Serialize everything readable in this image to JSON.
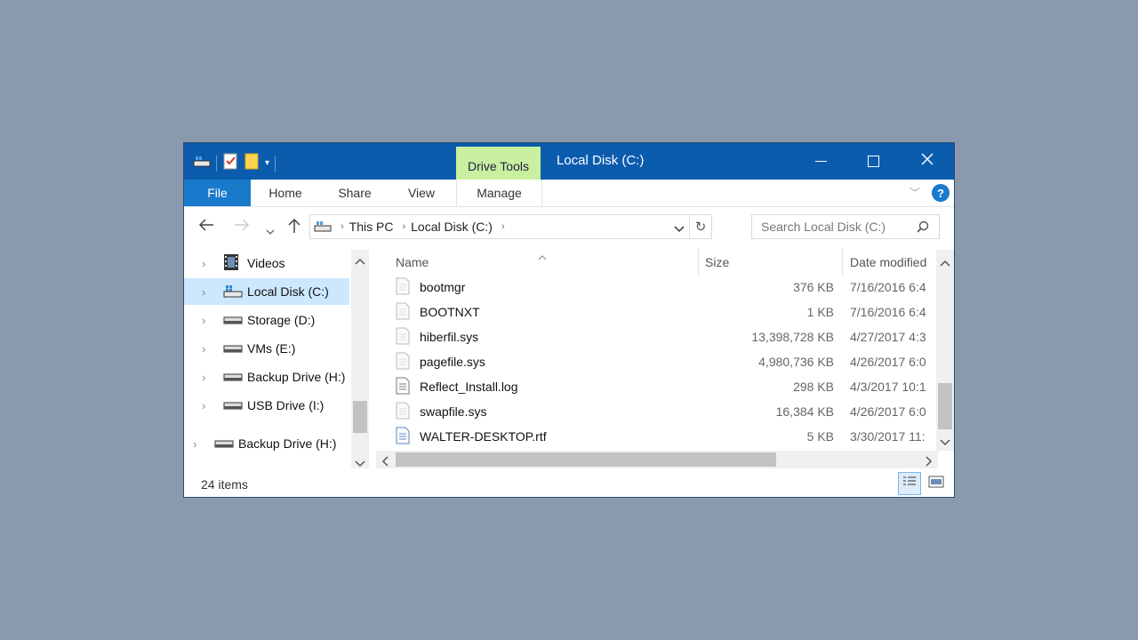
{
  "window": {
    "title": "Local Disk (C:)",
    "context_tab": "Drive Tools",
    "controls": {
      "minimize": "—",
      "maximize": "☐",
      "close": "✕"
    }
  },
  "ribbon": {
    "tabs": [
      {
        "label": "File"
      },
      {
        "label": "Home"
      },
      {
        "label": "Share"
      },
      {
        "label": "View"
      },
      {
        "label": "Manage"
      }
    ],
    "help": "?"
  },
  "address_bar": {
    "breadcrumbs": [
      "This PC",
      "Local Disk (C:)"
    ]
  },
  "search": {
    "placeholder": "Search Local Disk (C:)"
  },
  "nav_pane": {
    "items": [
      {
        "label": "Videos",
        "icon": "videos-icon"
      },
      {
        "label": "Local Disk (C:)",
        "icon": "local-disk-icon",
        "selected": true
      },
      {
        "label": "Storage (D:)",
        "icon": "drive-icon"
      },
      {
        "label": "VMs (E:)",
        "icon": "drive-icon"
      },
      {
        "label": "Backup Drive (H:)",
        "icon": "drive-icon"
      },
      {
        "label": "USB Drive (I:)",
        "icon": "drive-icon"
      },
      {
        "label": "Backup Drive (H:)",
        "icon": "drive-icon"
      }
    ]
  },
  "file_list": {
    "columns": [
      "Name",
      "Size",
      "Date modified"
    ],
    "rows": [
      {
        "name": "bootmgr",
        "size": "376 KB",
        "date": "7/16/2016 6:4"
      },
      {
        "name": "BOOTNXT",
        "size": "1 KB",
        "date": "7/16/2016 6:4"
      },
      {
        "name": "hiberfil.sys",
        "size": "13,398,728 KB",
        "date": "4/27/2017 4:3"
      },
      {
        "name": "pagefile.sys",
        "size": "4,980,736 KB",
        "date": "4/26/2017 6:0"
      },
      {
        "name": "Reflect_Install.log",
        "size": "298 KB",
        "date": "4/3/2017 10:1"
      },
      {
        "name": "swapfile.sys",
        "size": "16,384 KB",
        "date": "4/26/2017 6:0"
      },
      {
        "name": "WALTER-DESKTOP.rtf",
        "size": "5 KB",
        "date": "3/30/2017 11:"
      }
    ]
  },
  "status_bar": {
    "item_count": "24 items"
  },
  "colors": {
    "titlebar": "#0b5cad",
    "context_tab": "#c8f0a0",
    "file_tab": "#1979ca",
    "selection": "#cce8ff",
    "desktop": "#8a9aac"
  }
}
